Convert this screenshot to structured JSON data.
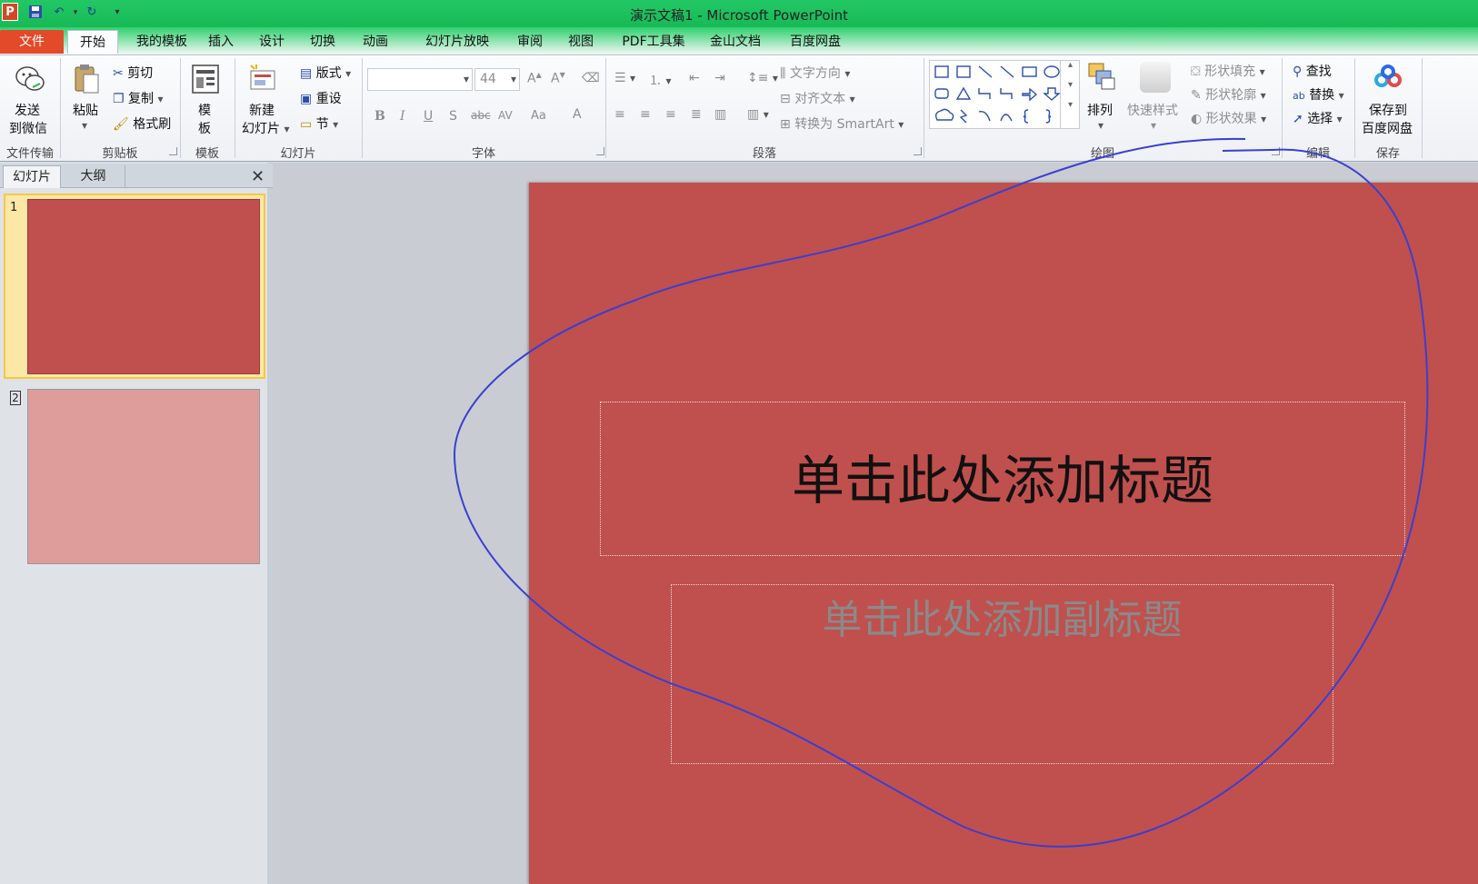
{
  "app": {
    "icon_letter": "P",
    "title": "演示文稿1 - Microsoft PowerPoint"
  },
  "quick_access": {
    "save_icon": "save-icon",
    "undo_icon": "undo-icon",
    "redo_icon": "redo-icon",
    "customize_icon": "customize-qat-icon"
  },
  "tabs": [
    "文件",
    "开始",
    "我的模板",
    "插入",
    "设计",
    "切换",
    "动画",
    "幻灯片放映",
    "审阅",
    "视图",
    "PDF工具集",
    "金山文档",
    "百度网盘"
  ],
  "ribbon": {
    "groups": [
      "文件传输",
      "剪贴板",
      "模板",
      "幻灯片",
      "字体",
      "段落",
      "绘图",
      "编辑",
      "保存"
    ],
    "send_wechat": {
      "line1": "发送",
      "line2": "到微信"
    },
    "paste": "粘贴",
    "cut": "剪切",
    "copy": "复制",
    "format_painter": "格式刷",
    "template": {
      "line1": "模",
      "line2": "板"
    },
    "new_slide": {
      "line1": "新建",
      "line2": "幻灯片"
    },
    "layout": "版式",
    "reset": "重设",
    "section": "节",
    "font_size": "44",
    "font_buttons": [
      "B",
      "I",
      "U",
      "S",
      "abc",
      "AV",
      "Aa",
      "A"
    ],
    "text_direction": "文字方向",
    "align_text": "对齐文本",
    "convert_smartart": "转换为 SmartArt",
    "arrange": "排列",
    "quick_styles": "快速样式",
    "shape_fill": "形状填充",
    "shape_outline": "形状轮廓",
    "shape_effects": "形状效果",
    "find": "查找",
    "replace": "替换",
    "select": "选择",
    "save_baidu": {
      "line1": "保存到",
      "line2": "百度网盘"
    }
  },
  "pane": {
    "tab_slides": "幻灯片",
    "tab_outline": "大纲",
    "slide_numbers": [
      "1",
      "2"
    ]
  },
  "slide": {
    "title_placeholder": "单击此处添加标题",
    "subtitle_placeholder": "单击此处添加副标题"
  },
  "colors": {
    "title_bar": "#22c865",
    "file_tab": "#e34a2a",
    "slide_bg": "#c0504d",
    "thumb2_bg": "#de9d9b",
    "annotation": "#3b3fd0"
  }
}
